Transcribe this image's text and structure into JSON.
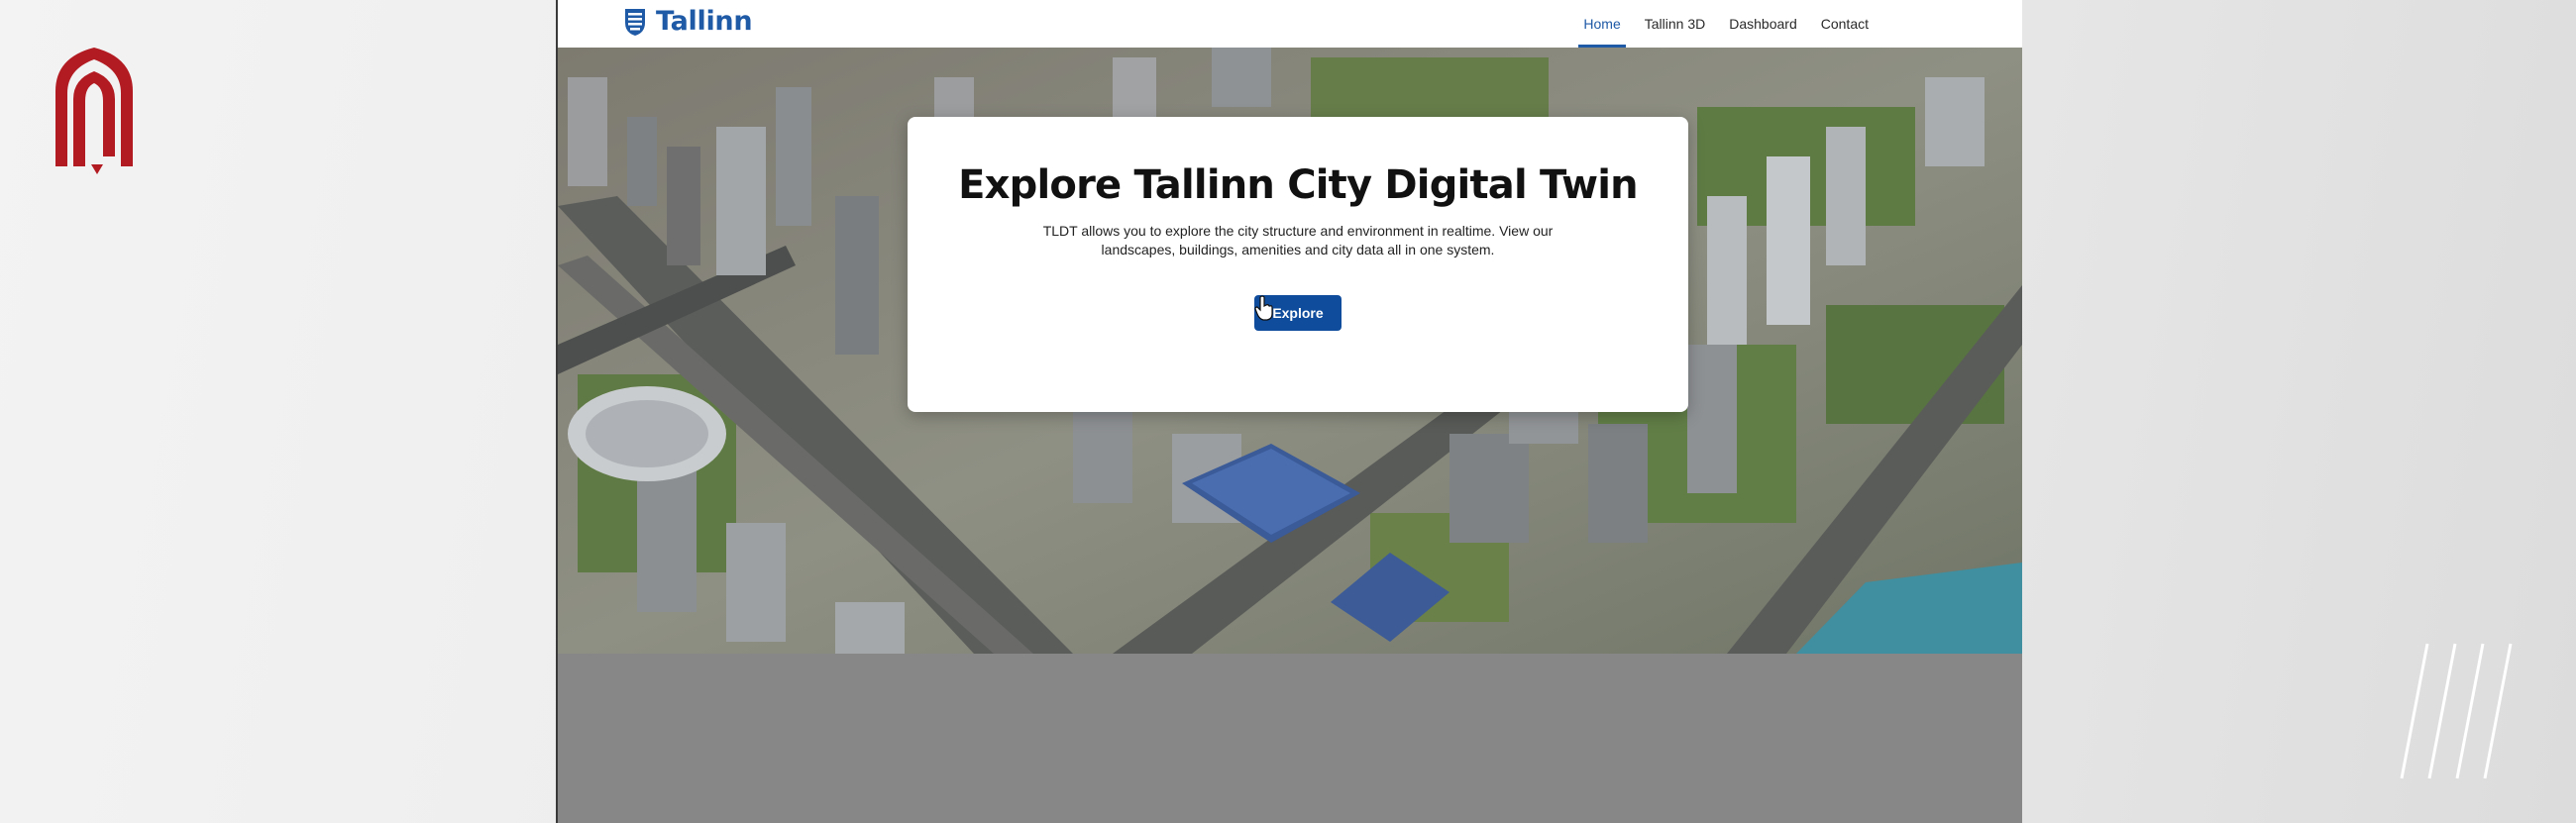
{
  "app": {
    "brand_name": "Tallinn"
  },
  "nav": {
    "items": [
      {
        "label": "Home",
        "active": true
      },
      {
        "label": "Tallinn 3D",
        "active": false
      },
      {
        "label": "Dashboard",
        "active": false
      },
      {
        "label": "Contact",
        "active": false
      }
    ]
  },
  "hero": {
    "title": "Explore Tallinn City Digital Twin",
    "description": "TLDT allows you to explore the city structure and environment in realtime.  View our landscapes, buildings, amenities and city data all in one system.",
    "button_label": "Explore"
  },
  "icons": {
    "side_logo": "arch-logo-icon",
    "brand_logo": "tallinn-shield-icon",
    "cursor": "hand-pointer-icon",
    "decor": "diagonal-slashes-icon"
  },
  "colors": {
    "brand_blue": "#1f5aa6",
    "button_blue": "#0f4c9c",
    "side_logo_red": "#b31b22",
    "footer_gray": "#878787"
  }
}
